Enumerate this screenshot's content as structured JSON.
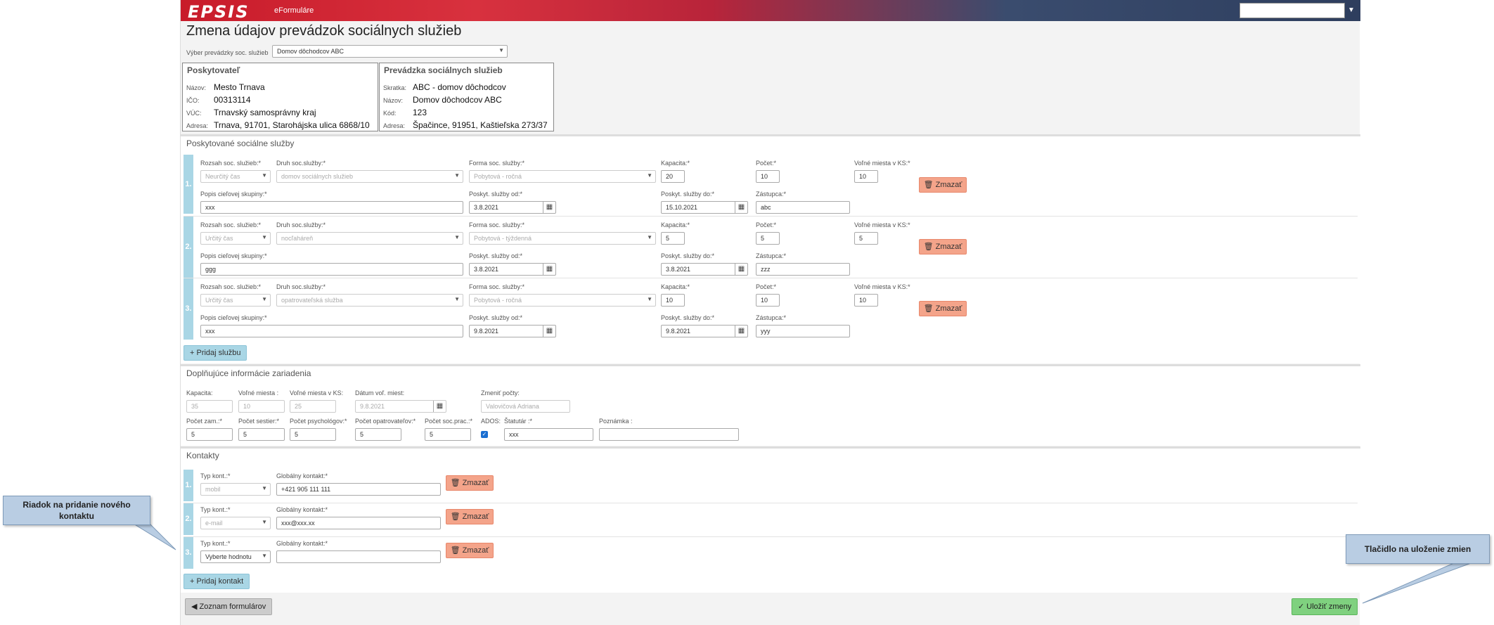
{
  "header": {
    "logo": "EPSIS",
    "sub": "eFormuláre"
  },
  "title": "Zmena údajov prevádzok sociálnych služieb",
  "facility_select": {
    "label": "Výber prevádzky soc. služieb",
    "value": "Domov dôchodcov ABC"
  },
  "provider": {
    "title": "Poskytovateľ",
    "rows": [
      {
        "label": "Názov:",
        "value": "Mesto Trnava"
      },
      {
        "label": "IČO:",
        "value": "00313114"
      },
      {
        "label": "VÚC:",
        "value": "Trnavský samosprávny kraj"
      },
      {
        "label": "Adresa:",
        "value": "Trnava, 91701, Starohájska ulica 6868/10"
      }
    ]
  },
  "facility": {
    "title": "Prevádzka sociálnych služieb",
    "rows": [
      {
        "label": "Skratka:",
        "value": "ABC - domov dôchodcov"
      },
      {
        "label": "Názov:",
        "value": "Domov dôchodcov ABC"
      },
      {
        "label": "Kód:",
        "value": "123"
      },
      {
        "label": "Adresa:",
        "value": "Špačince, 91951, Kaštieľska 273/37"
      }
    ]
  },
  "services": {
    "title": "Poskytované sociálne služby",
    "labels": {
      "rozsah": "Rozsah soc. služieb:*",
      "druh": "Druh soc.služby:*",
      "forma": "Forma soc. služby:*",
      "kapacita": "Kapacita:*",
      "pocet": "Počet:*",
      "volne": "Voľné miesta v KS:*",
      "popis": "Popis cieľovej skupiny:*",
      "od": "Poskyt. služby od:*",
      "do": "Poskyt. služby do:*",
      "zastupca": "Zástupca:*"
    },
    "rows": [
      {
        "num": "1.",
        "rozsah": "Neurčitý čas",
        "druh": "domov sociálnych služieb",
        "forma": "Pobytová - ročná",
        "kapacita": "20",
        "pocet": "10",
        "volne": "10",
        "popis": "xxx",
        "od": "3.8.2021",
        "do": "15.10.2021",
        "zastupca": "abc"
      },
      {
        "num": "2.",
        "rozsah": "Určitý čas",
        "druh": "nocľaháreň",
        "forma": "Pobytová - týždenná",
        "kapacita": "5",
        "pocet": "5",
        "volne": "5",
        "popis": "ggg",
        "od": "3.8.2021",
        "do": "3.8.2021",
        "zastupca": "zzz"
      },
      {
        "num": "3.",
        "rozsah": "Určitý čas",
        "druh": "opatrovateľská služba",
        "forma": "Pobytová - ročná",
        "kapacita": "10",
        "pocet": "10",
        "volne": "10",
        "popis": "xxx",
        "od": "9.8.2021",
        "do": "9.8.2021",
        "zastupca": "yyy"
      }
    ],
    "delete_label": "Zmazať",
    "add_label": "Pridaj službu"
  },
  "extra": {
    "title": "Doplňujúce informácie zariadenia",
    "top": [
      {
        "label": "Kapacita:",
        "value": "35"
      },
      {
        "label": "Voľné miesta :",
        "value": "10"
      },
      {
        "label": "Voľné miesta v KS:",
        "value": "25"
      },
      {
        "label": "Dátum voľ. miest:",
        "value": "9.8.2021"
      },
      {
        "label": "Zmeniť počty:",
        "value": "Valovičová Adriana"
      }
    ],
    "bottom": [
      {
        "label": "Počet zam.:*",
        "value": "5"
      },
      {
        "label": "Počet sestier:*",
        "value": "5"
      },
      {
        "label": "Počet psychológov:*",
        "value": "5"
      },
      {
        "label": "Počet opatrovateľov:*",
        "value": "5"
      },
      {
        "label": "Počet soc.prac.:*",
        "value": "5"
      },
      {
        "label": "ADOS:",
        "value": ""
      },
      {
        "label": "Štatutár :*",
        "value": "xxx"
      },
      {
        "label": "Poznámka :",
        "value": ""
      }
    ]
  },
  "contacts": {
    "title": "Kontakty",
    "type_label": "Typ kont.:*",
    "global_label": "Globálny kontakt:*",
    "rows": [
      {
        "num": "1.",
        "type": "mobil",
        "value": "+421 905 111 111"
      },
      {
        "num": "2.",
        "type": "e-mail",
        "value": "xxx@xxx.xx"
      },
      {
        "num": "3.",
        "type": "Vyberte hodnotu",
        "value": ""
      }
    ],
    "delete_label": "Zmazať",
    "add_label": "Pridaj kontakt"
  },
  "footer": {
    "list_label": "Zoznam formulárov",
    "save_label": "Uložiť zmeny"
  },
  "callouts": {
    "add_row": "Riadok na pridanie nového kontaktu",
    "save": "Tlačidlo na uloženie zmien"
  }
}
